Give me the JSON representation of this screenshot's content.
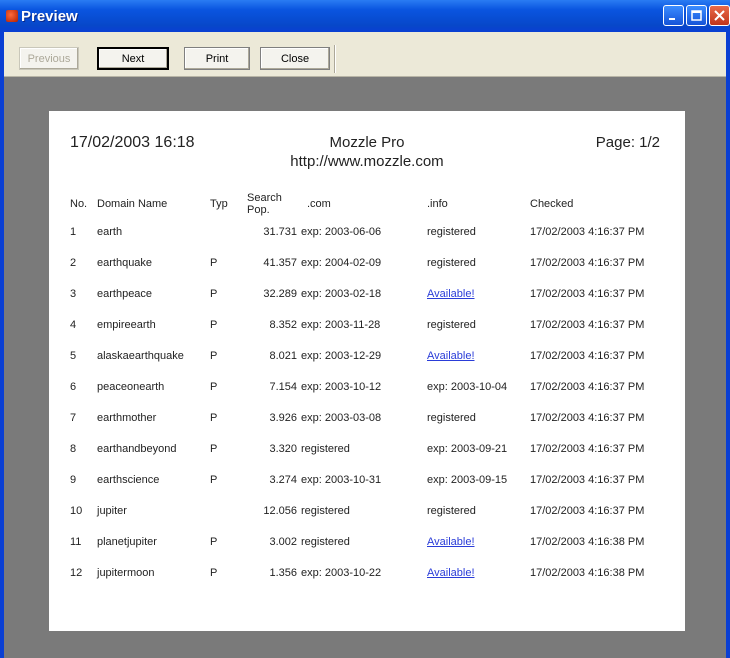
{
  "window": {
    "title": "Preview"
  },
  "toolbar": {
    "previous_label": "Previous",
    "next_label": "Next",
    "print_label": "Print",
    "close_label": "Close"
  },
  "report": {
    "date": "17/02/2003 16:18",
    "title": "Mozzle Pro",
    "url": "http://www.mozzle.com",
    "page": "Page: 1/2",
    "columns": [
      "No.",
      "Domain Name",
      "Typ",
      "Search Pop.",
      ".com",
      ".info",
      "Checked"
    ],
    "rows": [
      {
        "no": "1",
        "domain": "earth",
        "typ": "",
        "pop": "31.731",
        "com": "exp: 2003-06-06",
        "info": "registered",
        "checked": "17/02/2003 4:16:37 PM"
      },
      {
        "no": "2",
        "domain": "earthquake",
        "typ": "P",
        "pop": "41.357",
        "com": "exp: 2004-02-09",
        "info": "registered",
        "checked": "17/02/2003 4:16:37 PM"
      },
      {
        "no": "3",
        "domain": "earthpeace",
        "typ": "P",
        "pop": "32.289",
        "com": "exp: 2003-02-18",
        "info": "Available!",
        "checked": "17/02/2003 4:16:37 PM"
      },
      {
        "no": "4",
        "domain": "empireearth",
        "typ": "P",
        "pop": "8.352",
        "com": "exp: 2003-11-28",
        "info": "registered",
        "checked": "17/02/2003 4:16:37 PM"
      },
      {
        "no": "5",
        "domain": "alaskaearthquake",
        "typ": "P",
        "pop": "8.021",
        "com": "exp: 2003-12-29",
        "info": "Available!",
        "checked": "17/02/2003 4:16:37 PM"
      },
      {
        "no": "6",
        "domain": "peaceonearth",
        "typ": "P",
        "pop": "7.154",
        "com": "exp: 2003-10-12",
        "info": "exp: 2003-10-04",
        "checked": "17/02/2003 4:16:37 PM"
      },
      {
        "no": "7",
        "domain": "earthmother",
        "typ": "P",
        "pop": "3.926",
        "com": "exp: 2003-03-08",
        "info": "registered",
        "checked": "17/02/2003 4:16:37 PM"
      },
      {
        "no": "8",
        "domain": "earthandbeyond",
        "typ": "P",
        "pop": "3.320",
        "com": "registered",
        "info": "exp: 2003-09-21",
        "checked": "17/02/2003 4:16:37 PM"
      },
      {
        "no": "9",
        "domain": "earthscience",
        "typ": "P",
        "pop": "3.274",
        "com": "exp: 2003-10-31",
        "info": "exp: 2003-09-15",
        "checked": "17/02/2003 4:16:37 PM"
      },
      {
        "no": "10",
        "domain": "jupiter",
        "typ": "",
        "pop": "12.056",
        "com": "registered",
        "info": "registered",
        "checked": "17/02/2003 4:16:37 PM"
      },
      {
        "no": "11",
        "domain": "planetjupiter",
        "typ": "P",
        "pop": "3.002",
        "com": "registered",
        "info": "Available!",
        "checked": "17/02/2003 4:16:38 PM"
      },
      {
        "no": "12",
        "domain": "jupitermoon",
        "typ": "P",
        "pop": "1.356",
        "com": "exp: 2003-10-22",
        "info": "Available!",
        "checked": "17/02/2003 4:16:38 PM"
      }
    ]
  },
  "colors": {
    "titlebar": "#0a55e0",
    "link": "#2a3cd8",
    "backdrop": "#7a7a7a"
  }
}
